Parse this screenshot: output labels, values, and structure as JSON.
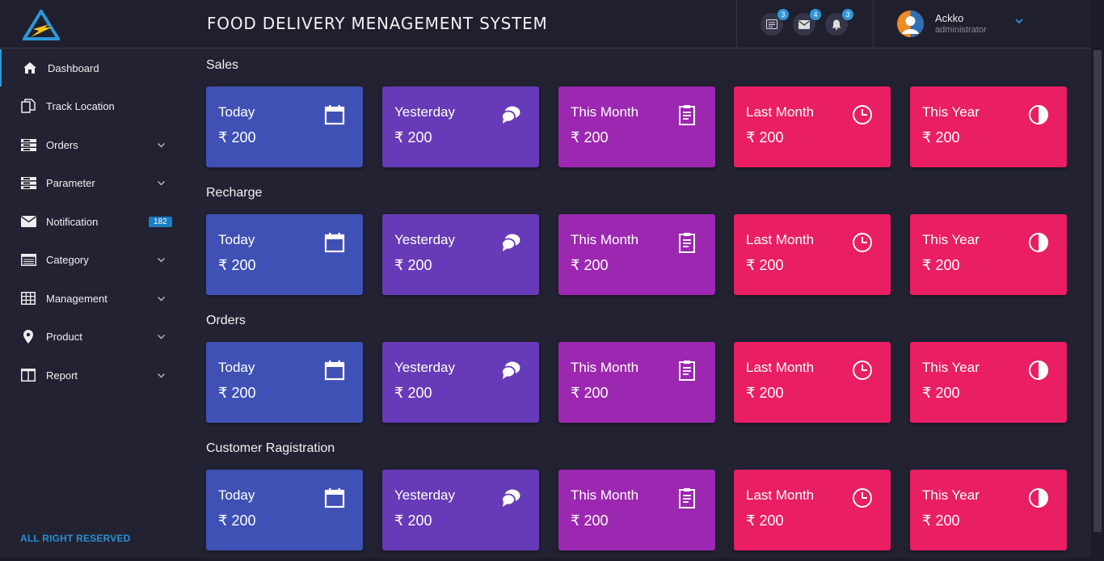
{
  "header": {
    "title": "FOOD DELIVERY MENAGEMENT SYSTEM",
    "icons": [
      {
        "name": "messages",
        "badge": "3"
      },
      {
        "name": "mail",
        "badge": "4"
      },
      {
        "name": "notifications",
        "badge": "3"
      }
    ],
    "user": {
      "name": "Ackko",
      "role": "administrator"
    }
  },
  "sidebar": {
    "items": [
      {
        "label": "Dashboard",
        "icon": "home-icon"
      },
      {
        "label": "Track Location",
        "icon": "copy-icon"
      },
      {
        "label": "Orders",
        "icon": "list-icon"
      },
      {
        "label": "Parameter",
        "icon": "list-icon"
      },
      {
        "label": "Notification",
        "icon": "envelope-icon",
        "count": "182"
      },
      {
        "label": "Category",
        "icon": "table-icon"
      },
      {
        "label": "Management",
        "icon": "grid-icon"
      },
      {
        "label": "Product",
        "icon": "pin-icon"
      },
      {
        "label": "Report",
        "icon": "columns-icon"
      }
    ],
    "footer": "ALL RIGHT RESERVED"
  },
  "sections": [
    {
      "title": "Sales"
    },
    {
      "title": "Recharge"
    },
    {
      "title": "Orders"
    },
    {
      "title": "Customer Ragistration"
    }
  ],
  "cards": [
    {
      "label": "Today",
      "value": "₹ 200",
      "color": "#3f51b5",
      "icon": "calendar-icon"
    },
    {
      "label": "Yesterday",
      "value": "₹ 200",
      "color": "#673ab7",
      "icon": "chat-icon"
    },
    {
      "label": "This Month",
      "value": "₹ 200",
      "color": "#9c27b0",
      "icon": "clipboard-icon"
    },
    {
      "label": "Last Month",
      "value": "₹ 200",
      "color": "#e91e63",
      "icon": "clock-icon"
    },
    {
      "label": "This Year",
      "value": "₹ 200",
      "color": "#e91e63",
      "icon": "contrast-icon"
    }
  ]
}
